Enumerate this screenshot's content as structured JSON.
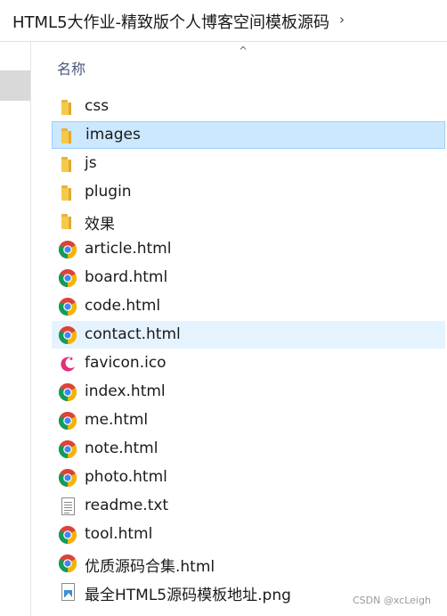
{
  "address": {
    "path": "HTML5大作业-精致版个人博客空间模板源码",
    "chevron": "›"
  },
  "column_header": {
    "name": "名称",
    "sort_indicator": "^"
  },
  "files": [
    {
      "name": "css",
      "type": "folder",
      "state": "normal"
    },
    {
      "name": "images",
      "type": "folder",
      "state": "selected"
    },
    {
      "name": "js",
      "type": "folder",
      "state": "normal"
    },
    {
      "name": "plugin",
      "type": "folder",
      "state": "normal"
    },
    {
      "name": "效果",
      "type": "folder",
      "state": "normal"
    },
    {
      "name": "article.html",
      "type": "chrome-html",
      "state": "normal"
    },
    {
      "name": "board.html",
      "type": "chrome-html",
      "state": "normal"
    },
    {
      "name": "code.html",
      "type": "chrome-html",
      "state": "normal"
    },
    {
      "name": "contact.html",
      "type": "chrome-html",
      "state": "hover"
    },
    {
      "name": "favicon.ico",
      "type": "ico",
      "state": "normal"
    },
    {
      "name": "index.html",
      "type": "chrome-html",
      "state": "normal"
    },
    {
      "name": "me.html",
      "type": "chrome-html",
      "state": "normal"
    },
    {
      "name": "note.html",
      "type": "chrome-html",
      "state": "normal"
    },
    {
      "name": "photo.html",
      "type": "chrome-html",
      "state": "normal"
    },
    {
      "name": "readme.txt",
      "type": "txt",
      "state": "normal"
    },
    {
      "name": "tool.html",
      "type": "chrome-html",
      "state": "normal"
    },
    {
      "name": "优质源码合集.html",
      "type": "chrome-html",
      "state": "normal"
    },
    {
      "name": "最全HTML5源码模板地址.png",
      "type": "png",
      "state": "normal"
    }
  ],
  "watermark": "CSDN @xcLeigh",
  "colors": {
    "selected_bg": "#cce8ff",
    "hover_bg": "#e5f3ff",
    "folder": "#f5c94c"
  }
}
